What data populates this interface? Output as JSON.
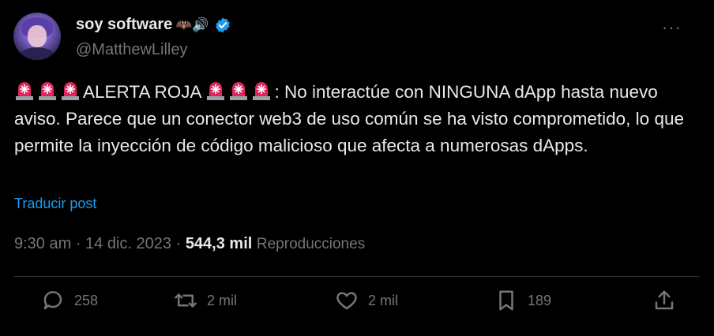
{
  "tweet": {
    "display_name": "soy software",
    "name_emoji": "🦇🔊",
    "handle": "@MatthewLilley",
    "more": "···",
    "text_prefix": "ALERTA ROJA ",
    "text_body": ": No interactúe con NINGUNA dApp hasta nuevo aviso. Parece que un conector web3 de uso común se ha visto comprometido, lo que permite la inyección de código malicioso que afecta a numerosas dApps.",
    "translate": "Traducir post",
    "time": "9:30 am",
    "sep": " · ",
    "date": "14 dic. 2023",
    "views": "544,3 mil",
    "views_label": "Reproducciones",
    "replies": "258",
    "reposts": "2 mil",
    "likes": "2 mil",
    "bookmarks": "189",
    "icons": {
      "verified": "verified-badge-icon",
      "siren": "police-light-emoji",
      "reply": "reply-icon",
      "repost": "repost-icon",
      "like": "heart-icon",
      "bookmark": "bookmark-icon",
      "share": "share-icon"
    },
    "colors": {
      "accent": "#1d9bf0",
      "muted": "#71767b",
      "text": "#e7e9ea",
      "bg": "#000000"
    }
  }
}
